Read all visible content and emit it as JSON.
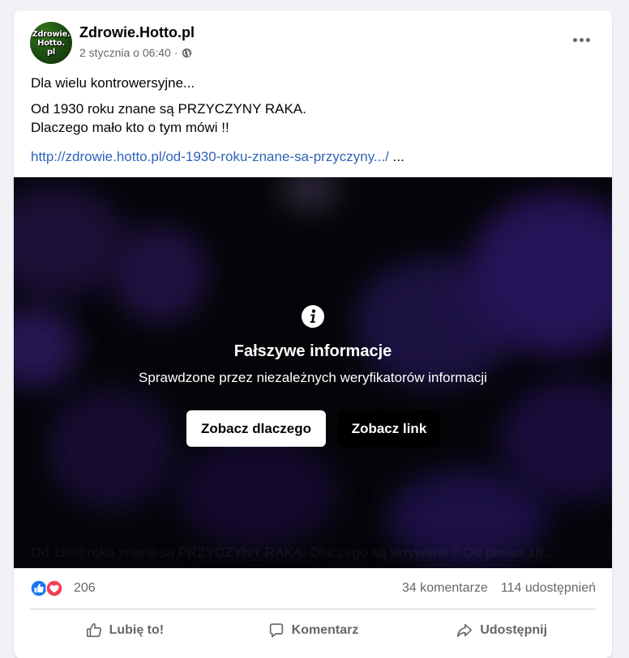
{
  "post": {
    "page_name": "Zdrowie.Hotto.pl",
    "avatar_text": [
      "Zdrowie.",
      "Hotto.",
      "pl"
    ],
    "timestamp": "2 stycznia o 06:40",
    "separator": "·",
    "audience_icon": "globe-icon",
    "more_icon": "more-options-icon",
    "text_line1": "Dla wielu kontrowersyjne...",
    "text_line2": "Od 1930 roku znane są PRZYCZYNY RAKA.",
    "text_line3": "Dlaczego mało kto o tym mówi  !!",
    "link": "http://zdrowie.hotto.pl/od-1930-roku-znane-sa-przyczyny.../",
    "link_ellipsis": "..."
  },
  "fact_check": {
    "icon": "info-icon",
    "title": "Fałszywe informacje",
    "subtitle": "Sprawdzone przez niezależnych weryfikatorów informacji",
    "see_why_label": "Zobacz dlaczego",
    "see_link_label": "Zobacz link",
    "background_text": "Od 1930 roku znane są PRZYCZYNY RAKA. Dlaczego są skrywane !! Od ponad 18..."
  },
  "stats": {
    "reaction_icons": [
      "like-reaction-icon",
      "love-reaction-icon"
    ],
    "reaction_count": "206",
    "comments": "34 komentarze",
    "shares": "114 udostępnień"
  },
  "actions": {
    "like_label": "Lubię to!",
    "comment_label": "Komentarz",
    "share_label": "Udostępnij"
  },
  "colors": {
    "link": "#2e64b8",
    "like_blue": "#1877f2",
    "love_red": "#f33e58",
    "muted": "#65676b"
  }
}
